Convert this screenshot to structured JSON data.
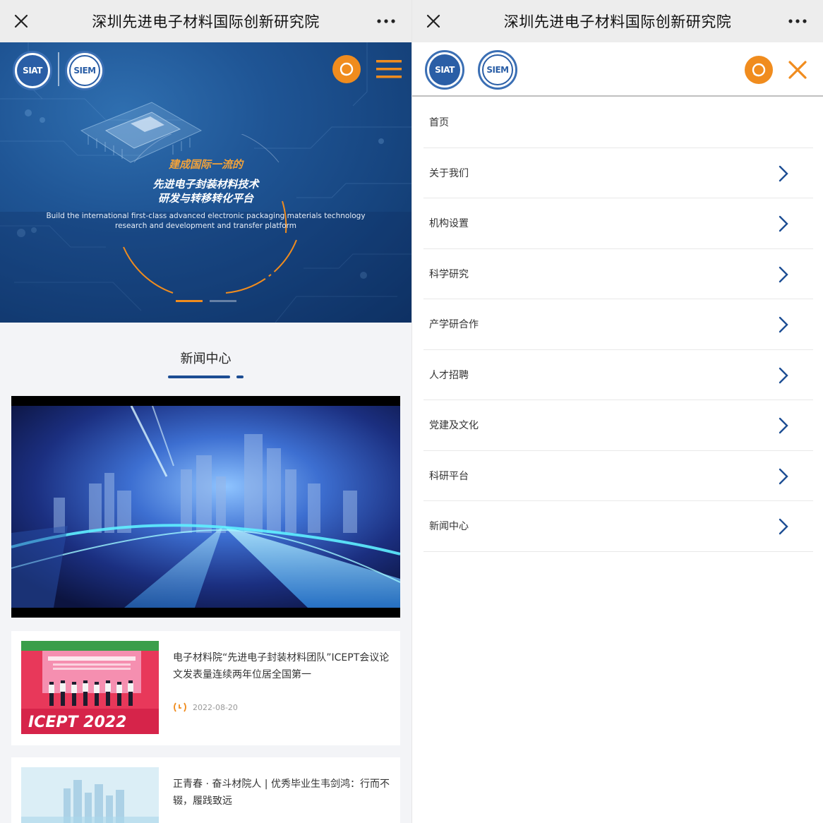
{
  "left": {
    "window_title": "深圳先进电子材料国际创新研究院",
    "logos": [
      "SIAT",
      "SIEM"
    ],
    "icons": [
      "close-icon",
      "more-icon",
      "search-icon",
      "menu-icon"
    ],
    "hero": {
      "line1": "建成国际一流的",
      "line2": "先进电子封装材料技术",
      "line3": "研发与转移转化平台",
      "en_line1": "Build the international first-class advanced electronic packaging materials technology",
      "en_line2": "research and development and transfer platform",
      "slide_count": 2,
      "active_slide": 1
    },
    "section_title": "新闻中心",
    "news": [
      {
        "title": "电子材料院“先进电子封装材料团队”ICEPT会议论文发表量连续两年位居全国第一",
        "date": "2022-08-20",
        "thumb_text": "ICEPT 2022"
      },
      {
        "title": "正青春 · 奋斗材院人 | 优秀毕业生韦剑鸿：行而不辍，履践致远"
      }
    ]
  },
  "right": {
    "window_title": "深圳先进电子材料国际创新研究院",
    "logos": [
      "SIAT",
      "SIEM"
    ],
    "menu": [
      {
        "label": "首页",
        "has_arrow": false
      },
      {
        "label": "关于我们",
        "has_arrow": true
      },
      {
        "label": "机构设置",
        "has_arrow": true
      },
      {
        "label": "科学研究",
        "has_arrow": true
      },
      {
        "label": "产学研合作",
        "has_arrow": true
      },
      {
        "label": "人才招聘",
        "has_arrow": true
      },
      {
        "label": "党建及文化",
        "has_arrow": true
      },
      {
        "label": "科研平台",
        "has_arrow": true
      },
      {
        "label": "新闻中心",
        "has_arrow": true
      }
    ]
  },
  "colors": {
    "accent_orange": "#f08c1e",
    "brand_blue": "#1c4d93",
    "hero_blue": "#1f5595"
  }
}
